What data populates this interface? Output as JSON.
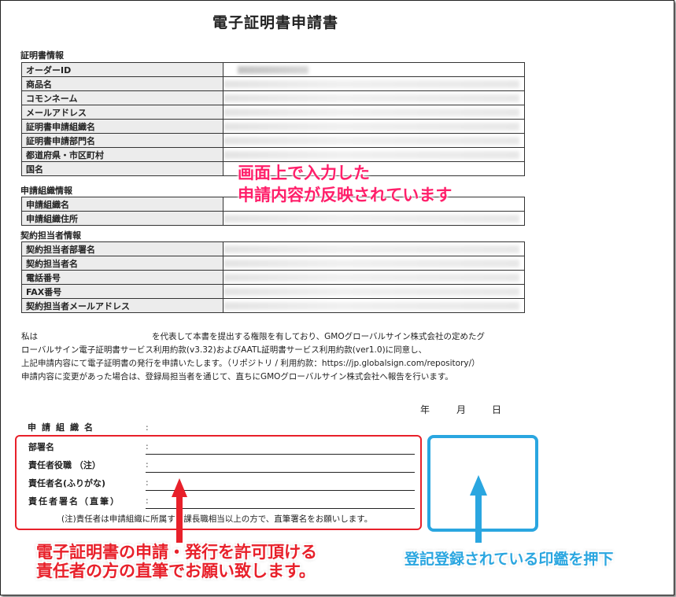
{
  "document": {
    "title": "電子証明書申請書"
  },
  "sections": {
    "cert_info": "証明書情報",
    "org_info": "申請組織情報",
    "contact_info": "契約担当者情報"
  },
  "cert_info_rows": [
    "オーダーID",
    "商品名",
    "コモンネーム",
    "メールアドレス",
    "証明書申請組織名",
    "証明書申請部門名",
    "都道府県・市区町村",
    "国名"
  ],
  "org_info_rows": [
    "申請組織名",
    "申請組織住所"
  ],
  "contact_info_rows": [
    "契約担当者部署名",
    "契約担当者名",
    "電話番号",
    "FAX番号",
    "契約担当者メールアドレス"
  ],
  "statement": {
    "line1_a": "私は",
    "line1_b": "を代表して本書を提出する権限を有しており、GMOグローバルサイン株式会社の定めたグ",
    "line2": "ローバルサイン電子証明書サービス利用約款(v3.32)およびAATL証明書サービス利用約款(ver1.0)に同意し、",
    "line3": "上記申請内容にて電子証明書の発行を申請いたします。（リポジトリ / 利用約款：https://jp.globalsign.com/repository/）",
    "line4": "申請内容に変更があった場合は、登録局担当者を通じて、直ちにGMOグローバルサイン株式会社へ報告を行います。"
  },
  "date": {
    "year": "年",
    "month": "月",
    "day": "日"
  },
  "signature": {
    "org_name": "申請組織名",
    "colon": ":",
    "dept": "部署名",
    "position": "責任者役職 （注）",
    "name_kana": "責任者名(ふりがな)",
    "signature": "責任者署名（直筆）",
    "note": "(注)責任者は申請組織に所属する課長職相当以上の方で、直筆署名をお願いします。"
  },
  "callouts": {
    "reflect_line1": "画面上で入力した",
    "reflect_line2": "申請内容が反映されています",
    "sign_line1": "電子証明書の申請・発行を許可頂ける",
    "sign_line2": "責任者の方の直筆でお願い致します。",
    "stamp": "登記登録されている印鑑を押下"
  },
  "colors": {
    "callout_pink": "#ff1f6a",
    "callout_red": "#e8202a",
    "callout_blue": "#2aa6e0"
  }
}
